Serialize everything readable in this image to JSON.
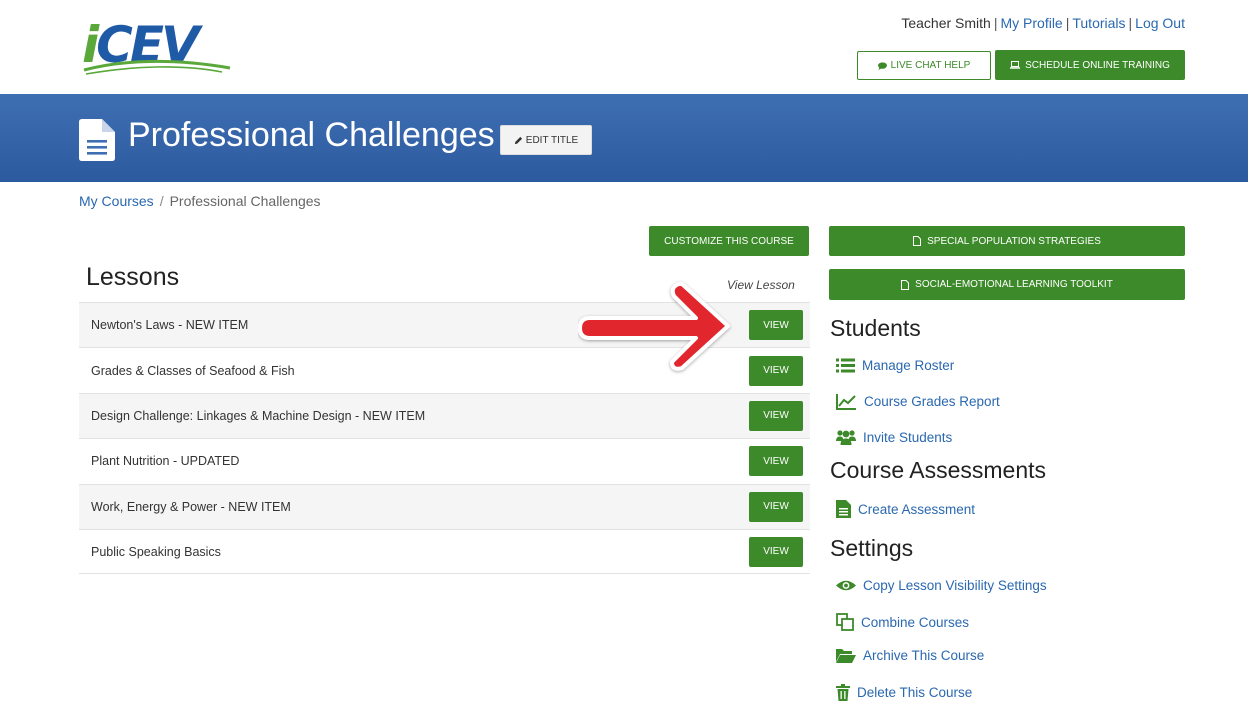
{
  "header": {
    "logo": "iCEV",
    "user_name": "Teacher Smith",
    "links": [
      "My Profile",
      "Tutorials",
      "Log Out"
    ],
    "live_chat_label": "LIVE CHAT HELP",
    "schedule_label": "SCHEDULE ONLINE TRAINING"
  },
  "banner": {
    "title": "Professional Challenges",
    "edit_label": "EDIT TITLE"
  },
  "breadcrumb": {
    "root": "My Courses",
    "separator": "/",
    "current": "Professional Challenges"
  },
  "actions": {
    "customize_label": "CUSTOMIZE THIS COURSE",
    "special_population_label": "SPECIAL POPULATION STRATEGIES",
    "sel_toolkit_label": "SOCIAL-EMOTIONAL LEARNING TOOLKIT"
  },
  "lessons": {
    "heading": "Lessons",
    "column_label": "View Lesson",
    "view_label": "VIEW",
    "items": [
      {
        "name": "Newton's Laws - NEW ITEM"
      },
      {
        "name": "Grades & Classes of Seafood & Fish"
      },
      {
        "name": "Design Challenge: Linkages & Machine Design - NEW ITEM"
      },
      {
        "name": "Plant Nutrition - UPDATED"
      },
      {
        "name": "Work, Energy & Power - NEW ITEM"
      },
      {
        "name": "Public Speaking Basics"
      }
    ]
  },
  "students": {
    "heading": "Students",
    "links": [
      {
        "label": "Manage Roster",
        "icon": "list-icon"
      },
      {
        "label": "Course Grades Report",
        "icon": "line-chart-icon"
      },
      {
        "label": "Invite Students",
        "icon": "users-icon"
      }
    ]
  },
  "assessments": {
    "heading": "Course Assessments",
    "links": [
      {
        "label": "Create Assessment",
        "icon": "document-icon"
      }
    ]
  },
  "settings": {
    "heading": "Settings",
    "links": [
      {
        "label": "Copy Lesson Visibility Settings",
        "icon": "eye-icon"
      },
      {
        "label": "Combine Courses",
        "icon": "copy-icon"
      },
      {
        "label": "Archive This Course",
        "icon": "folder-open-icon"
      },
      {
        "label": "Delete This Course",
        "icon": "trash-icon"
      }
    ]
  },
  "colors": {
    "green": "#3d8a2a",
    "banner_blue": "#2c5a9e",
    "link_blue": "#2a68b0",
    "arrow_red": "#e1262d"
  }
}
